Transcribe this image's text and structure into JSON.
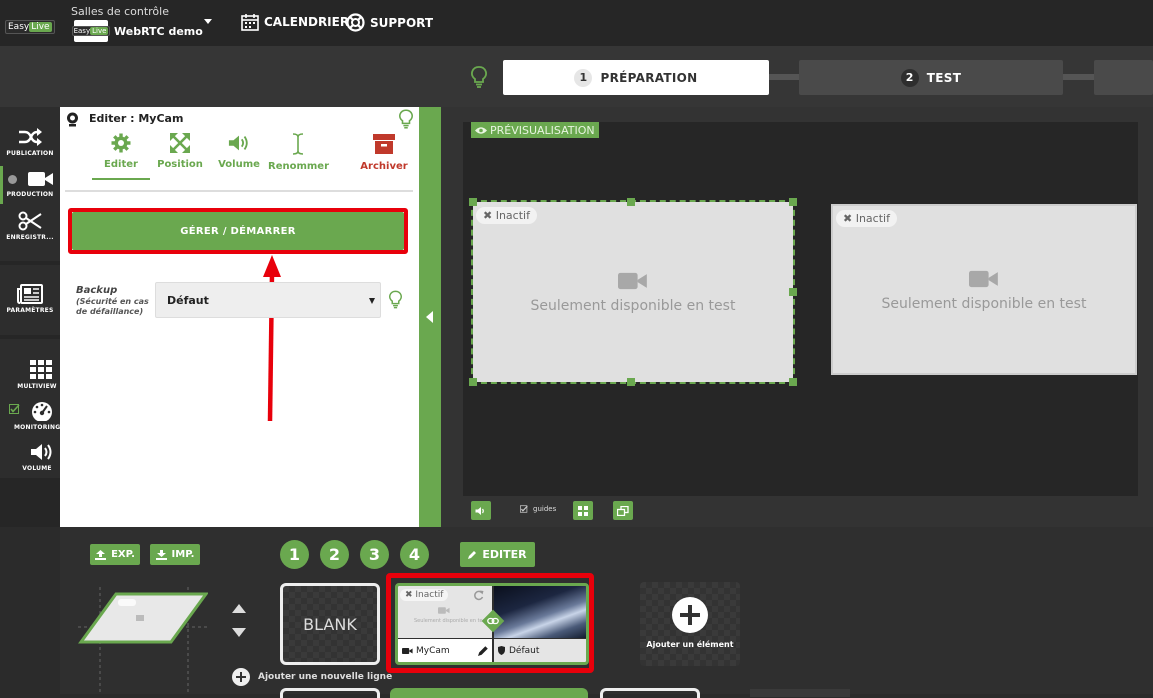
{
  "header": {
    "logo_text": "Easy",
    "logo_accent": "Live",
    "room_caption": "Salles de contrôle",
    "room_name": "WebRTC demo",
    "calendar_label": "CALENDRIER",
    "support_label": "SUPPORT"
  },
  "steps": [
    {
      "num": "1",
      "label": "PRÉPARATION"
    },
    {
      "num": "2",
      "label": "TEST"
    }
  ],
  "nav": {
    "publication": "PUBLICATION",
    "production": "PRODUCTION",
    "enregistrement": "ENREGISTR...",
    "parametres": "PARAMÈTRES",
    "multiview": "MULTIVIEW",
    "monitoring": "MONITORING",
    "volume": "VOLUME"
  },
  "edit": {
    "title": "Editer : MyCam",
    "tools": {
      "editer": "Editer",
      "position": "Position",
      "volume": "Volume",
      "renommer": "Renommer",
      "archiver": "Archiver"
    },
    "manage_button": "GÉRER / DÉMARRER",
    "backup_label": "Backup",
    "backup_sublabel": "(Sécurité en cas de défaillance)",
    "backup_value": "Défaut"
  },
  "preview": {
    "label": "PRÉVISUALISATION",
    "tiles": [
      {
        "status": "Inactif",
        "message": "Seulement disponible en test"
      },
      {
        "status": "Inactif",
        "message": "Seulement disponible en test"
      }
    ],
    "guides_label": "guides"
  },
  "bottom": {
    "exp_label": "EXP.",
    "imp_label": "IMP.",
    "layout_numbers": [
      "1",
      "2",
      "3",
      "4"
    ],
    "edit_label": "EDITER",
    "blank_label": "BLANK",
    "scene_status": "Inactif",
    "scene_message": "Seulement disponible en test",
    "scene_source": "MyCam",
    "scene_backup": "Défaut",
    "add_element": "Ajouter un élément",
    "add_line": "Ajouter une nouvelle ligne"
  },
  "colors": {
    "accent": "#6aa84f",
    "highlight": "#e8000b",
    "archive": "#c0392b"
  }
}
